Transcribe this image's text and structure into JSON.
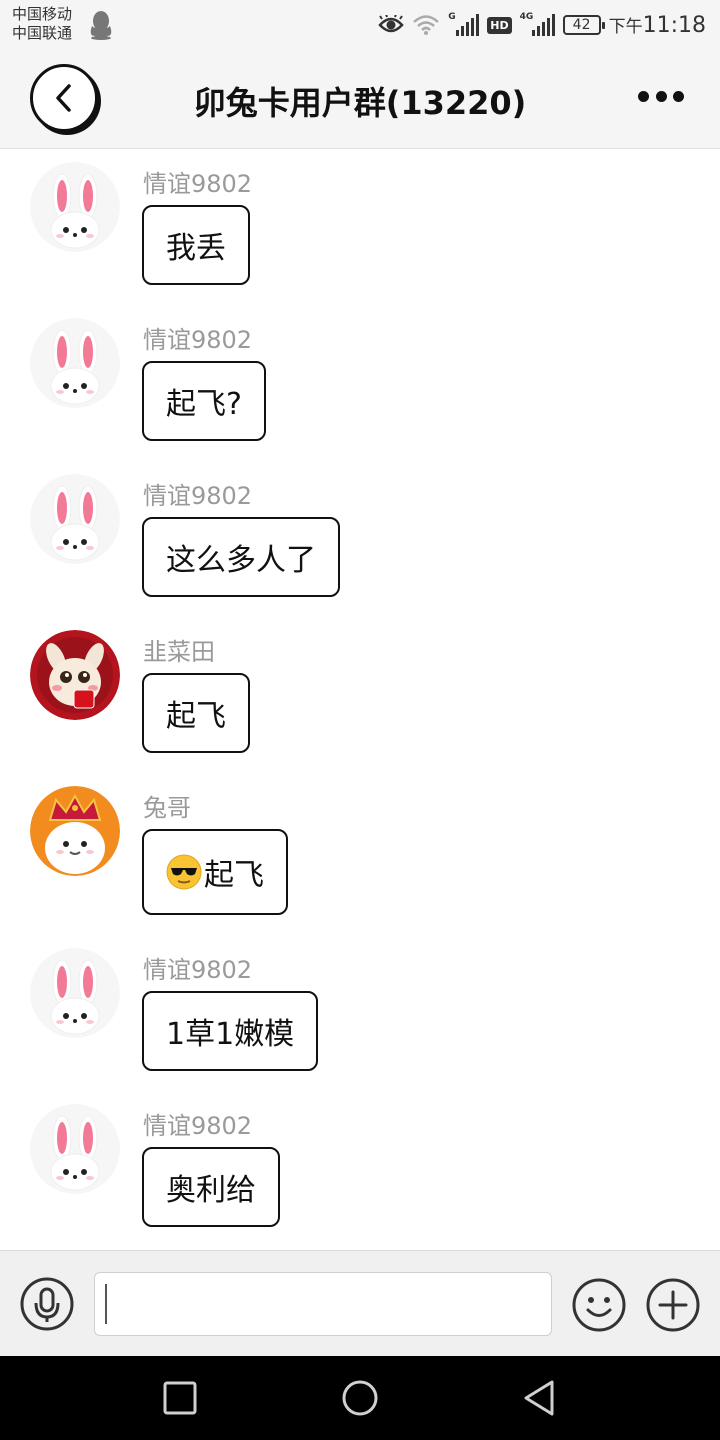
{
  "status_bar": {
    "carrier_1": "中国移动",
    "carrier_2": "中国联通",
    "sim1_network": "G",
    "hd_label": "HD",
    "sim2_network": "4G",
    "battery_level": "42",
    "time_prefix": "下午",
    "time": "11:18",
    "icons": [
      "qq-icon",
      "eye-icon",
      "wifi-icon",
      "signal-icon",
      "hd-icon",
      "signal-icon",
      "battery-icon"
    ]
  },
  "header": {
    "title": "卯兔卡用户群(13220)",
    "back_icon": "chevron-left-icon",
    "more_icon": "more-dots-icon"
  },
  "messages": [
    {
      "sender": "情谊9802",
      "text": "我丢",
      "avatar": "rabbit-avatar"
    },
    {
      "sender": "情谊9802",
      "text": "起飞?",
      "avatar": "rabbit-avatar"
    },
    {
      "sender": "情谊9802",
      "text": "这么多人了",
      "avatar": "rabbit-avatar"
    },
    {
      "sender": "韭菜田",
      "text": "起飞",
      "avatar": "red-bunny-avatar"
    },
    {
      "sender": "兔哥",
      "text": "起飞",
      "emoji": "sunglasses-emoji",
      "avatar": "crowned-bunny-avatar"
    },
    {
      "sender": "情谊9802",
      "text": "1草1嫩模",
      "avatar": "rabbit-avatar"
    },
    {
      "sender": "情谊9802",
      "text": "奥利给",
      "avatar": "rabbit-avatar"
    }
  ],
  "input_bar": {
    "text_value": "",
    "voice_icon": "microphone-icon",
    "emoji_icon": "smiley-icon",
    "plus_icon": "plus-icon"
  },
  "nav_bar": {
    "icons": [
      "recent-apps-icon",
      "home-icon",
      "back-icon"
    ]
  },
  "colors": {
    "header_bg": "#f5f5f5",
    "sender_name": "#9a9a9a",
    "bubble_border": "#111111",
    "nav_bg": "#000000"
  }
}
